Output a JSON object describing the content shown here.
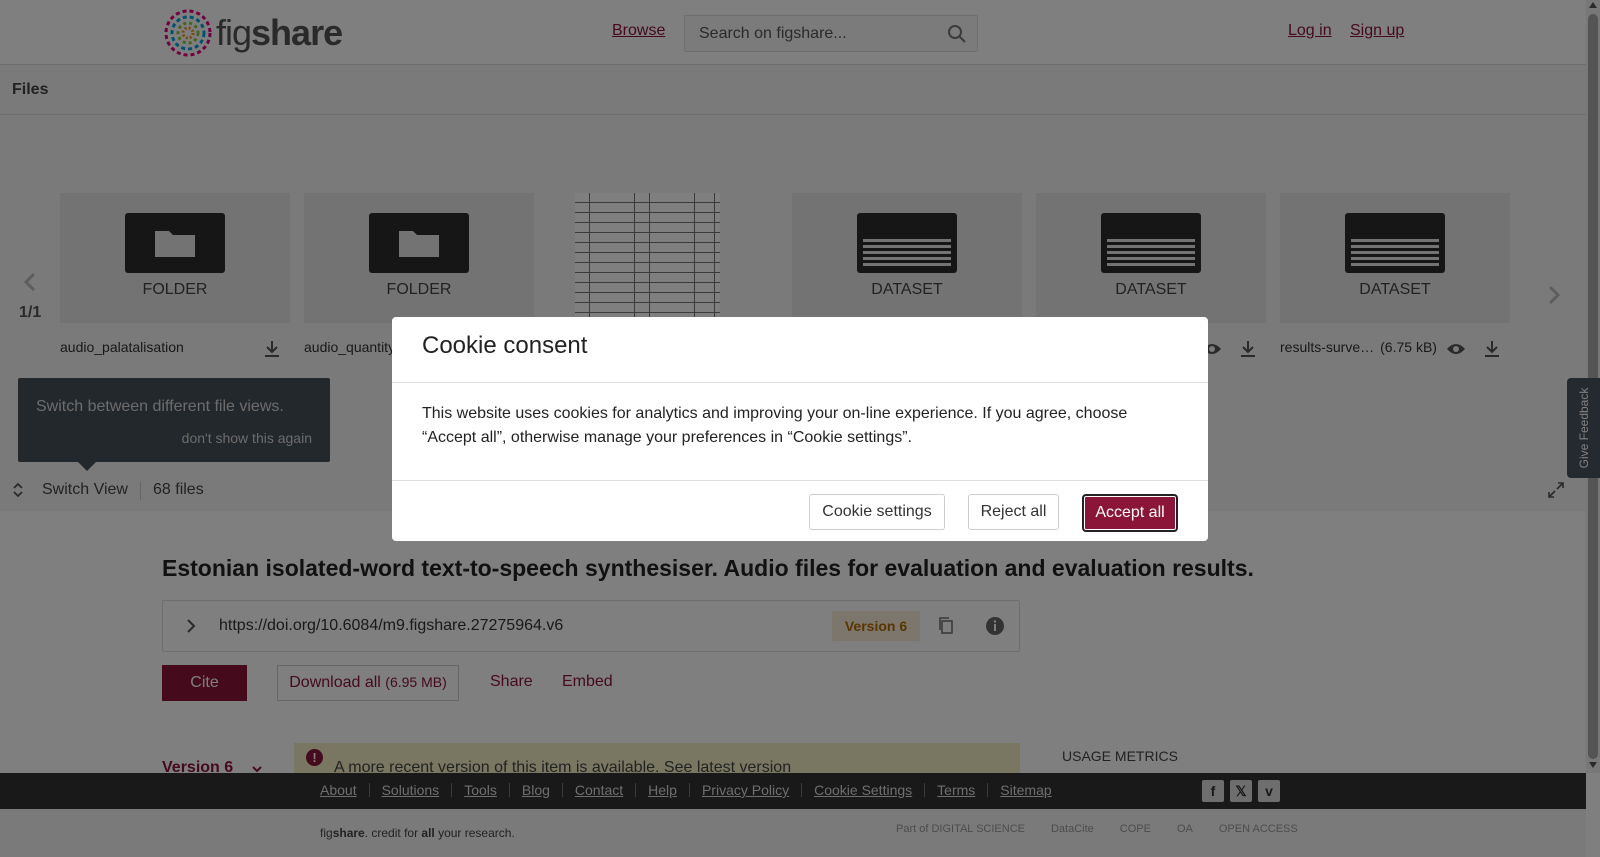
{
  "brand": {
    "name_light": "fig",
    "name_bold": "share",
    "accent": "#8a1538"
  },
  "header": {
    "browse": "Browse",
    "search_placeholder": "Search on figshare...",
    "login": "Log in",
    "signup": "Sign up"
  },
  "files": {
    "title": "Files",
    "page": "1/1",
    "tiles": [
      {
        "type": "FOLDER",
        "name": "audio_palatalisation",
        "size": ""
      },
      {
        "type": "FOLDER",
        "name": "audio_quantity",
        "size": ""
      },
      {
        "type": "DOCUMENT",
        "name": "",
        "size": ""
      },
      {
        "type": "DATASET",
        "name": "",
        "size": ""
      },
      {
        "type": "DATASET",
        "name": "",
        "size": ""
      },
      {
        "type": "DATASET",
        "name": "results-surve…",
        "size": "(6.75 kB)"
      }
    ],
    "tooltip_text": "Switch between different file views.",
    "tooltip_dismiss": "don't show this again",
    "switch_view": "Switch View",
    "count": "68 files"
  },
  "item": {
    "title": "Estonian isolated-word text-to-speech synthesiser. Audio files for evaluation and evaluation results.",
    "doi": "https://doi.org/10.6084/m9.figshare.27275964.v6",
    "version_badge": "Version 6",
    "cite": "Cite",
    "download_all": "Download all",
    "download_size": "(6.95 MB)",
    "share": "Share",
    "embed": "Embed",
    "version_toggle": "Version 6",
    "alert_text": "A more recent version of this item is available. See latest version",
    "usage_metrics": "USAGE METRICS"
  },
  "footer": {
    "links": [
      "About",
      "Solutions",
      "Tools",
      "Blog",
      "Contact",
      "Help",
      "Privacy Policy",
      "Cookie Settings",
      "Terms",
      "Sitemap"
    ],
    "tagline_light": "fig",
    "tagline_bold": "share",
    "tagline_rest_1": ". credit for ",
    "tagline_all": "all",
    "tagline_rest_2": " your research.",
    "partners": [
      "Part of DIGITAL SCIENCE",
      "DataCite",
      "COPE",
      "OA",
      "OPEN ACCESS"
    ]
  },
  "feedback": "Give Feedback",
  "cookie_modal": {
    "title": "Cookie consent",
    "body": "This website uses cookies for analytics and improving your on-line experience. If you agree, choose “Accept all”, otherwise manage your preferences in “Cookie settings”.",
    "settings": "Cookie settings",
    "reject": "Reject all",
    "accept": "Accept all"
  }
}
